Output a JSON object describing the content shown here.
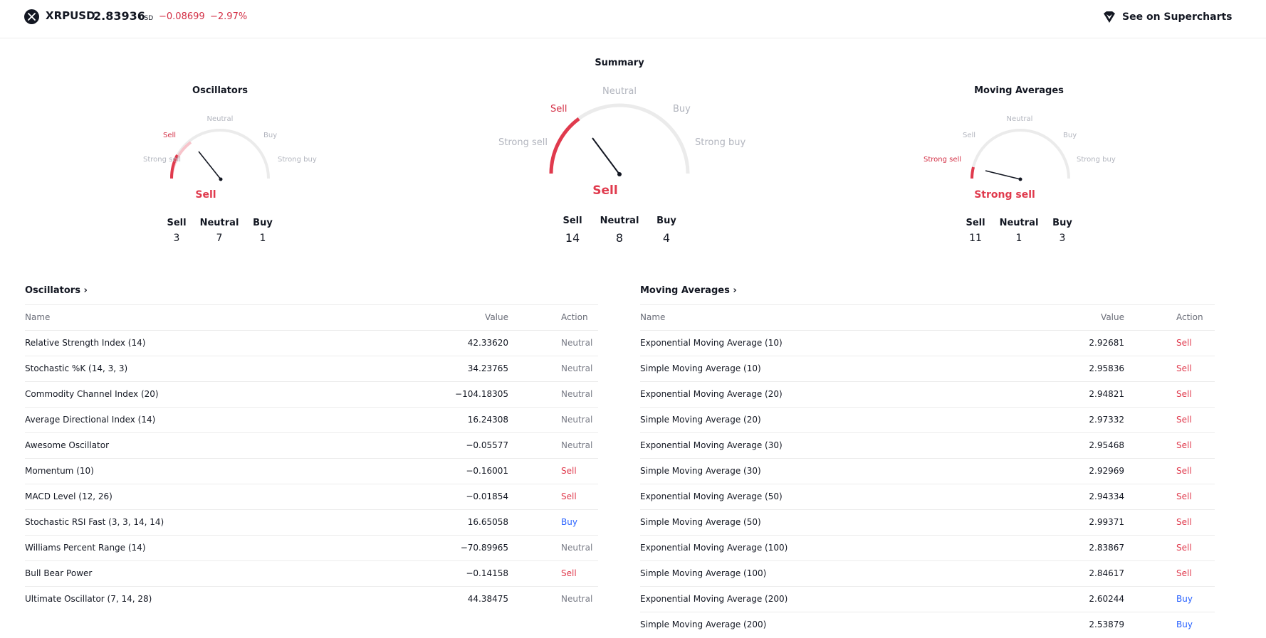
{
  "header": {
    "symbol": "XRPUSD",
    "price": "2.83936",
    "currency": "USD",
    "change": "−0.08699",
    "change_pct": "−2.97%",
    "supercharts_link": "See on Supercharts",
    "symbol_icon": "xrp-logo-icon",
    "supercharts_icon": "supercharts-icon"
  },
  "gauges": {
    "oscillators": {
      "title": "Oscillators",
      "labels": {
        "strong_sell": "Strong sell",
        "sell": "Sell",
        "neutral": "Neutral",
        "buy": "Buy",
        "strong_buy": "Strong buy"
      },
      "verdict": "Sell",
      "counts": {
        "sell_label": "Sell",
        "neutral_label": "Neutral",
        "buy_label": "Buy",
        "sell": "3",
        "neutral": "7",
        "buy": "1"
      }
    },
    "summary": {
      "title": "Summary",
      "labels": {
        "strong_sell": "Strong sell",
        "sell": "Sell",
        "neutral": "Neutral",
        "buy": "Buy",
        "strong_buy": "Strong buy"
      },
      "verdict": "Sell",
      "counts": {
        "sell_label": "Sell",
        "neutral_label": "Neutral",
        "buy_label": "Buy",
        "sell": "14",
        "neutral": "8",
        "buy": "4"
      }
    },
    "moving_averages": {
      "title": "Moving Averages",
      "labels": {
        "strong_sell": "Strong sell",
        "sell": "Sell",
        "neutral": "Neutral",
        "buy": "Buy",
        "strong_buy": "Strong buy"
      },
      "verdict": "Strong sell",
      "counts": {
        "sell_label": "Sell",
        "neutral_label": "Neutral",
        "buy_label": "Buy",
        "sell": "11",
        "neutral": "1",
        "buy": "3"
      }
    }
  },
  "oscillators_table": {
    "title": "Oscillators",
    "chevron": "›",
    "columns": {
      "name": "Name",
      "value": "Value",
      "action": "Action"
    },
    "rows": [
      {
        "name": "Relative Strength Index (14)",
        "value": "42.33620",
        "action": "Neutral"
      },
      {
        "name": "Stochastic %K (14, 3, 3)",
        "value": "34.23765",
        "action": "Neutral"
      },
      {
        "name": "Commodity Channel Index (20)",
        "value": "−104.18305",
        "action": "Neutral"
      },
      {
        "name": "Average Directional Index (14)",
        "value": "16.24308",
        "action": "Neutral"
      },
      {
        "name": "Awesome Oscillator",
        "value": "−0.05577",
        "action": "Neutral"
      },
      {
        "name": "Momentum (10)",
        "value": "−0.16001",
        "action": "Sell"
      },
      {
        "name": "MACD Level (12, 26)",
        "value": "−0.01854",
        "action": "Sell"
      },
      {
        "name": "Stochastic RSI Fast (3, 3, 14, 14)",
        "value": "16.65058",
        "action": "Buy"
      },
      {
        "name": "Williams Percent Range (14)",
        "value": "−70.89965",
        "action": "Neutral"
      },
      {
        "name": "Bull Bear Power",
        "value": "−0.14158",
        "action": "Sell"
      },
      {
        "name": "Ultimate Oscillator (7, 14, 28)",
        "value": "44.38475",
        "action": "Neutral"
      }
    ]
  },
  "moving_averages_table": {
    "title": "Moving Averages",
    "chevron": "›",
    "columns": {
      "name": "Name",
      "value": "Value",
      "action": "Action"
    },
    "rows": [
      {
        "name": "Exponential Moving Average (10)",
        "value": "2.92681",
        "action": "Sell"
      },
      {
        "name": "Simple Moving Average (10)",
        "value": "2.95836",
        "action": "Sell"
      },
      {
        "name": "Exponential Moving Average (20)",
        "value": "2.94821",
        "action": "Sell"
      },
      {
        "name": "Simple Moving Average (20)",
        "value": "2.97332",
        "action": "Sell"
      },
      {
        "name": "Exponential Moving Average (30)",
        "value": "2.95468",
        "action": "Sell"
      },
      {
        "name": "Simple Moving Average (30)",
        "value": "2.92969",
        "action": "Sell"
      },
      {
        "name": "Exponential Moving Average (50)",
        "value": "2.94334",
        "action": "Sell"
      },
      {
        "name": "Simple Moving Average (50)",
        "value": "2.99371",
        "action": "Sell"
      },
      {
        "name": "Exponential Moving Average (100)",
        "value": "2.83867",
        "action": "Sell"
      },
      {
        "name": "Simple Moving Average (100)",
        "value": "2.84617",
        "action": "Sell"
      },
      {
        "name": "Exponential Moving Average (200)",
        "value": "2.60244",
        "action": "Buy"
      },
      {
        "name": "Simple Moving Average (200)",
        "value": "2.53879",
        "action": "Buy"
      }
    ]
  },
  "colors": {
    "sell": "#e03a4d",
    "neutral": "#787b86",
    "buy": "#2962ff",
    "arc": "#e8e8e8",
    "arc_fill_light": "#f7c4cb"
  }
}
